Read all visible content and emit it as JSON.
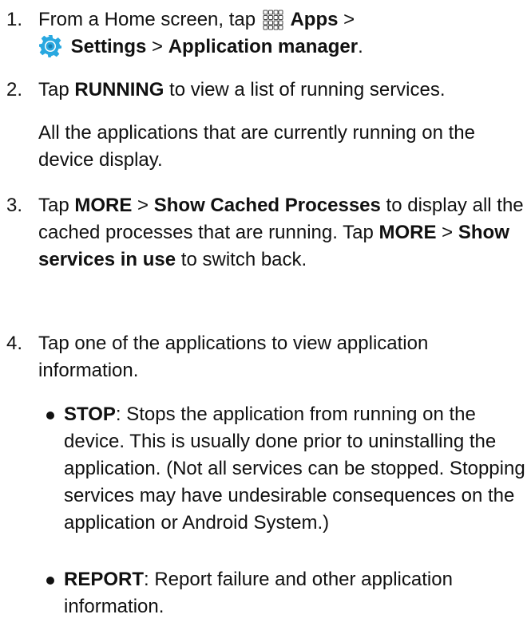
{
  "steps": [
    {
      "num": "1.",
      "pre": "From a Home screen, tap",
      "apps_icon": "apps-grid-icon",
      "apps": "Apps",
      "sep1": ">",
      "settings_icon": "settings-gear-icon",
      "settings": "Settings",
      "sep2": ">",
      "appmgr": "Application manager",
      "end": "."
    },
    {
      "num": "2.",
      "pre": "Tap",
      "bold": "RUNNING",
      "post": "to view a list of running services.",
      "note": "All the applications that are currently running on the device display."
    },
    {
      "num": "3.",
      "pre": "Tap",
      "more1": "MORE",
      "sep1": ">",
      "cached": "Show Cached Processes",
      "mid": "to display all the cached processes that are running. Tap",
      "more2": "MORE",
      "sep2": ">",
      "inuse": "Show services in use",
      "end": "to switch back."
    },
    {
      "num": "4.",
      "text": "Tap one of the applications to view application information."
    }
  ],
  "bullets": [
    {
      "label": "STOP",
      "text": ": Stops the application from running on the device. This is usually done prior to uninstalling the application. (Not all services can be stopped. Stopping services may have undesirable consequences on the application or Android System.)"
    },
    {
      "label": "REPORT",
      "text": ": Report failure and other application information."
    }
  ],
  "colors": {
    "text": "#111111",
    "settings_icon_fill": "#29a8e0",
    "settings_icon_dark": "#1b7fb3",
    "apps_icon_stroke": "#444444"
  }
}
